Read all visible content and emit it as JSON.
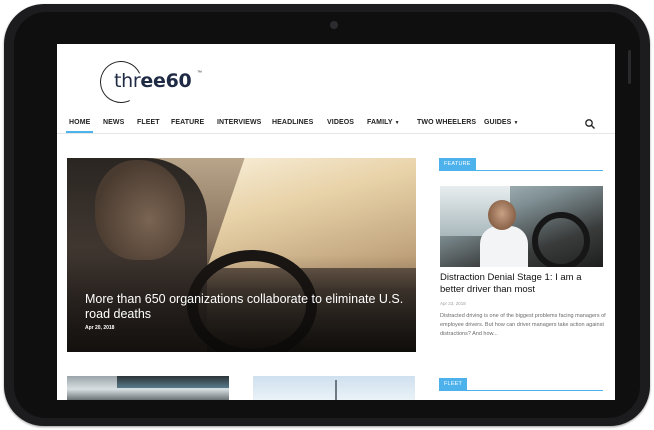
{
  "site": {
    "logo_text_light": "thr",
    "logo_text_bold": "ee60",
    "logo_tm": "™"
  },
  "nav": {
    "items": [
      {
        "label": "HOME",
        "active": true
      },
      {
        "label": "NEWS"
      },
      {
        "label": "FLEET"
      },
      {
        "label": "FEATURE"
      },
      {
        "label": "INTERVIEWS"
      },
      {
        "label": "HEADLINES"
      },
      {
        "label": "VIDEOS"
      },
      {
        "label": "FAMILY",
        "dropdown": true
      },
      {
        "label": "TWO WHEELERS"
      },
      {
        "label": "GUIDES",
        "dropdown": true
      }
    ],
    "search_icon": "search-icon",
    "accent_color": "#4db2ec"
  },
  "hero": {
    "title": "More than 650 organizations collaborate to eliminate U.S. road deaths",
    "date": "Apr 20, 2018"
  },
  "sidebar": {
    "feature_tag": "FEATURE",
    "feature_title": "Distraction Denial Stage 1: I am a better driver than most",
    "feature_date": "Apr 23, 2018",
    "feature_excerpt": "Distracted driving is one of the biggest problems facing managers of employee drivers. But how can driver managers take action against distractions? And how...",
    "fleet_tag": "FLEET"
  }
}
